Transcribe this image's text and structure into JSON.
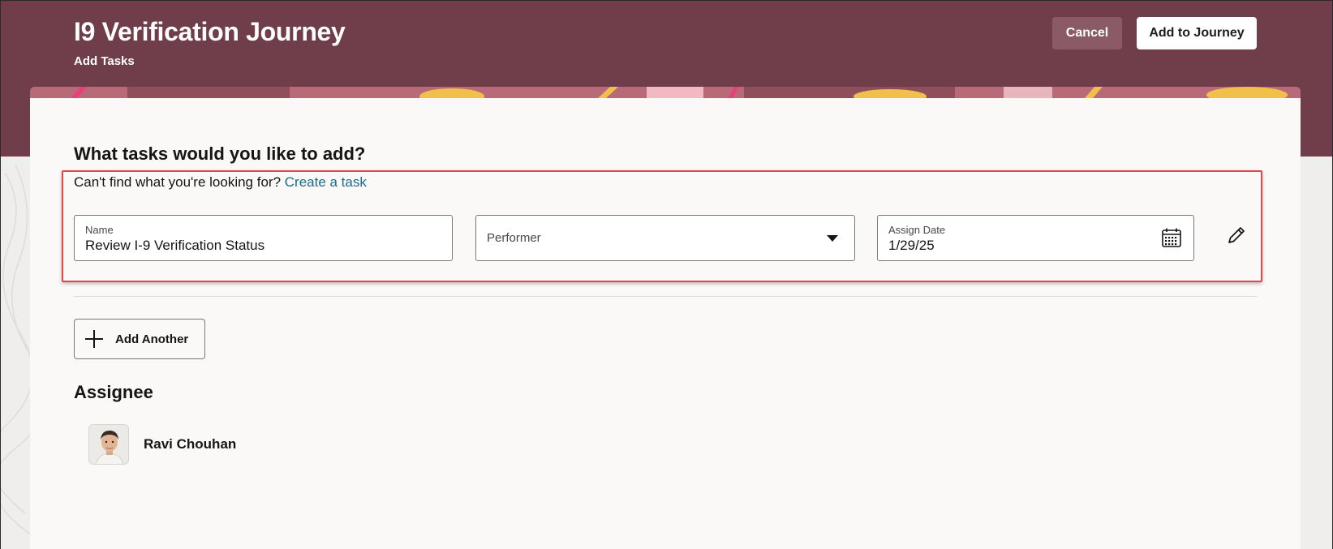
{
  "header": {
    "title": "I9 Verification Journey",
    "subtitle": "Add Tasks",
    "cancel_label": "Cancel",
    "add_to_journey_label": "Add to Journey"
  },
  "main": {
    "heading": "What tasks would you like to add?",
    "help_text": "Can't find what you're looking for? ",
    "create_task_link": "Create a task",
    "task_row": {
      "name_label": "Name",
      "name_value": "Review I-9 Verification Status",
      "performer_placeholder": "Performer",
      "assign_date_label": "Assign Date",
      "assign_date_value": "1/29/25"
    },
    "add_another_label": "Add Another",
    "assignee_heading": "Assignee",
    "assignee_name": "Ravi Chouhan"
  },
  "colors": {
    "header_bg": "#703d4a",
    "link": "#1a6b8a",
    "highlight_border": "#e0474c"
  },
  "icons": [
    "calendar-icon",
    "pencil-icon",
    "plus-icon",
    "caret-down-icon",
    "avatar"
  ]
}
